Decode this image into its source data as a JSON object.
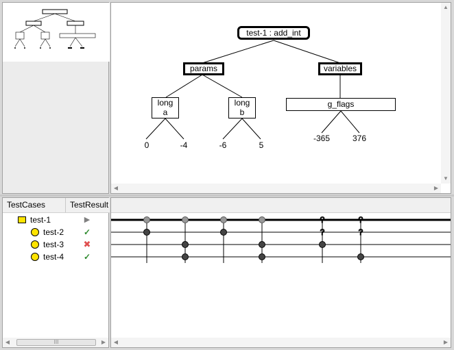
{
  "tree": {
    "root": "test-1 : add_int",
    "nodes": {
      "params": "params",
      "variables": "variables",
      "long_a": [
        "long",
        "a"
      ],
      "long_b": [
        "long",
        "b"
      ],
      "g_flags": "g_flags"
    },
    "leaves": {
      "a": [
        "0",
        "-4"
      ],
      "b": [
        "-6",
        "5"
      ],
      "g_flags": [
        "-365",
        "376"
      ]
    }
  },
  "test_list": {
    "headers": {
      "testcases": "TestCases",
      "testresult": "TestResult"
    },
    "rows": [
      {
        "name": "test-1",
        "icon": "folder-icon",
        "result": "play-icon",
        "result_glyph": "▶",
        "result_color": "#808080"
      },
      {
        "name": "test-2",
        "icon": "circle-icon",
        "result": "check-icon",
        "result_glyph": "✓",
        "result_color": "#2e8b2e"
      },
      {
        "name": "test-3",
        "icon": "circle-icon",
        "result": "cross-icon",
        "result_glyph": "✖",
        "result_color": "#e05050"
      },
      {
        "name": "test-4",
        "icon": "circle-icon",
        "result": "check-icon",
        "result_glyph": "✓",
        "result_color": "#2e8b2e"
      }
    ],
    "scroll_grip": "III"
  },
  "colors": {
    "icon_yellow": "#ffe400",
    "panel_bg": "#ffffff",
    "chrome": "#d8d8d8"
  }
}
